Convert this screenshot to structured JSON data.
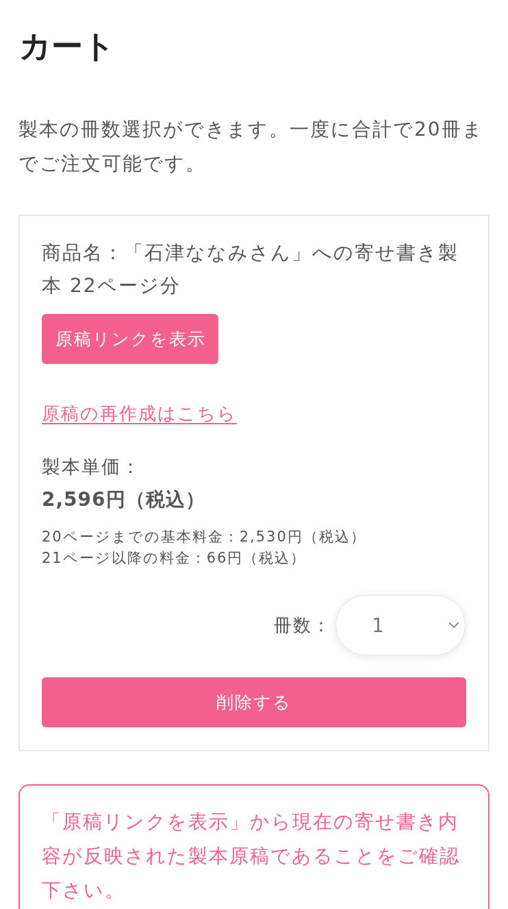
{
  "page": {
    "title": "カート",
    "intro": "製本の冊数選択ができます。一度に合計で20冊までご注文可能です。"
  },
  "cart_item": {
    "product_name": "商品名：「石津ななみさん」への寄せ書き製本 22ページ分",
    "show_draft_button": "原稿リンクを表示",
    "recreate_link": "原稿の再作成はこちら",
    "unit_price_label": "製本単価：",
    "unit_price": "2,596円（税込）",
    "price_notes": [
      "20ページまでの基本料金：2,530円（税込）",
      "21ページ以降の料金：66円（税込）"
    ],
    "quantity": {
      "label": "冊数：",
      "value": "1"
    },
    "delete_button": "削除する"
  },
  "notice": {
    "text": "「原稿リンクを表示」から現在の寄せ書き内容が反映された製本原稿であることをご確認下さい。"
  }
}
